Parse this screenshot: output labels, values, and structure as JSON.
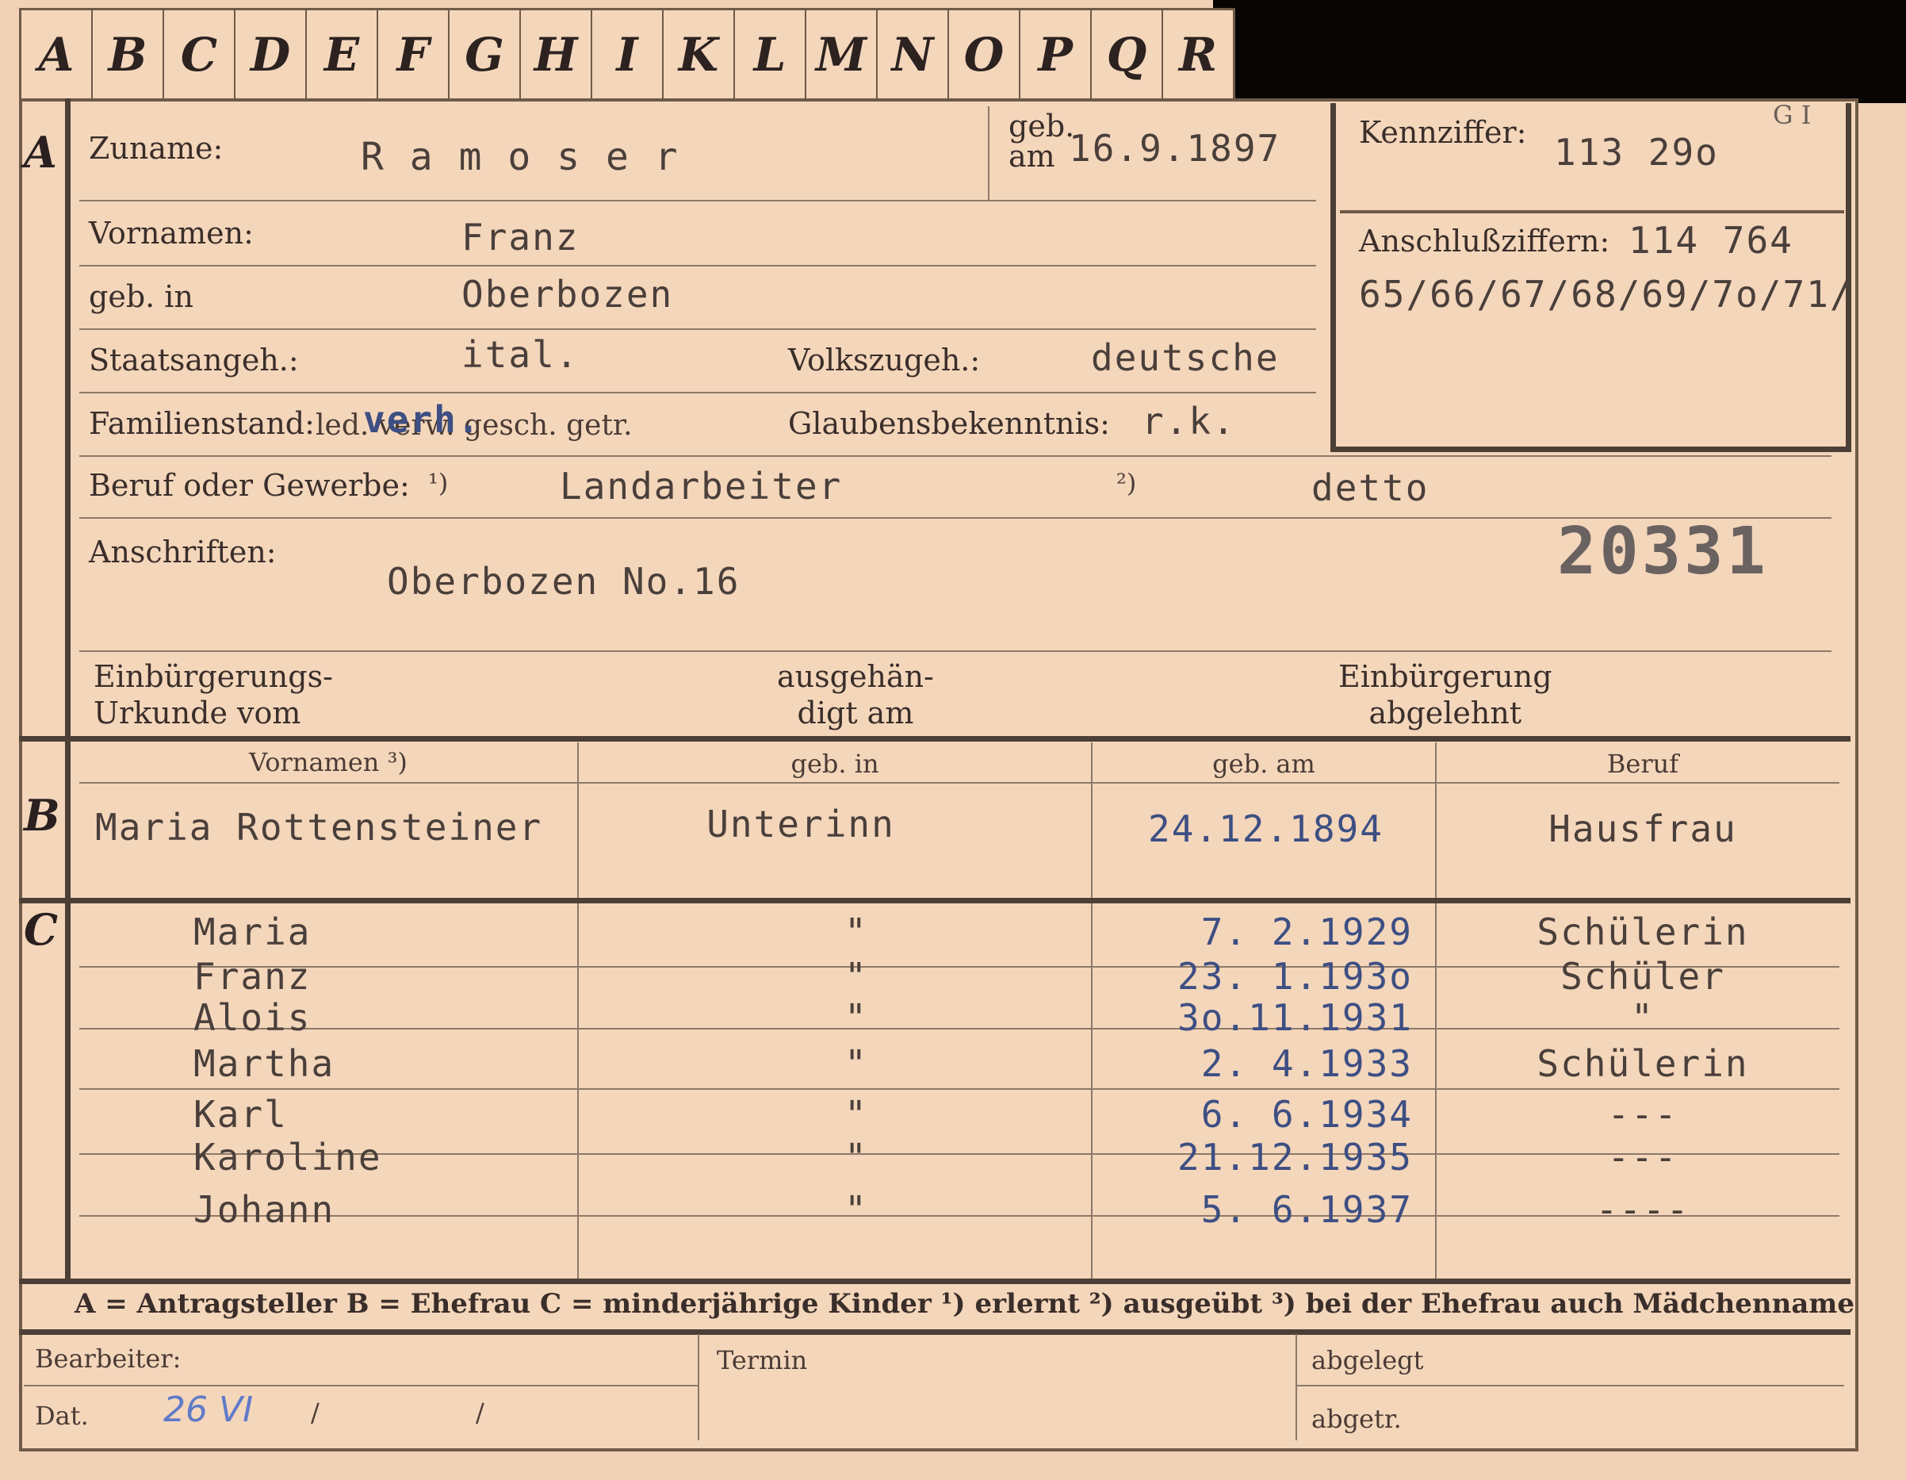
{
  "tabs": [
    "A",
    "B",
    "C",
    "D",
    "E",
    "F",
    "G",
    "H",
    "I",
    "K",
    "L",
    "M",
    "N",
    "O",
    "P",
    "Q",
    "R"
  ],
  "section_a": {
    "letter": "A",
    "zuname_label": "Zuname:",
    "zuname_value": "R a m o s e r",
    "geb_am_label_1": "geb.",
    "geb_am_label_2": "am",
    "geb_am_value": "16.9.1897",
    "kennziffer_label": "Kennziffer:",
    "kennziffer_value": "113 29o",
    "kennziffer_note": "G I",
    "anschluss_label": "Anschlußziffern:",
    "anschluss_value_1": "114 764",
    "anschluss_value_2": "65/66/67/68/69/7o/71/",
    "vornamen_label": "Vornamen:",
    "vornamen_value": "Franz",
    "geb_in_label": "geb. in",
    "geb_in_value": "Oberbozen",
    "staatsangeh_label": "Staatsangeh.:",
    "staatsangeh_value": "ital.",
    "volkszugeh_label": "Volkszugeh.:",
    "volkszugeh_value": "deutsche",
    "familienstand_label": "Familienstand:",
    "familienstand_options": "led. verw. gesch. getr.",
    "familienstand_value": "verh.",
    "glaubens_label": "Glaubensbekenntnis:",
    "glaubens_value": "r.k.",
    "beruf_label": "Beruf oder Gewerbe:",
    "beruf_note1": "¹)",
    "beruf_value1": "Landarbeiter",
    "beruf_note2": "²)",
    "beruf_value2": "detto",
    "anschriften_label": "Anschriften:",
    "anschriften_value": "Oberbozen No.16",
    "stamp_number": "20331",
    "einb_urkunde_1": "Einbürgerungs-",
    "einb_urkunde_2": "Urkunde vom",
    "ausgehaendigt_1": "ausgehän-",
    "ausgehaendigt_2": "digt am",
    "abgelehnt_1": "Einbürgerung",
    "abgelehnt_2": "abgelehnt"
  },
  "section_b": {
    "letter": "B",
    "headers": [
      "Vornamen ³)",
      "geb. in",
      "geb. am",
      "Beruf"
    ],
    "row": [
      "Maria Rottensteiner",
      "Unterinn",
      "24.12.1894",
      "Hausfrau"
    ]
  },
  "section_c": {
    "letter": "C",
    "rows": [
      [
        "Maria",
        "\"",
        "7. 2.1929",
        "Schülerin"
      ],
      [
        "Franz",
        "\"",
        "23. 1.193o",
        "Schüler"
      ],
      [
        "Alois",
        "\"",
        "3o.11.1931",
        "\""
      ],
      [
        "Martha",
        "\"",
        "2. 4.1933",
        "Schülerin"
      ],
      [
        "Karl",
        "\"",
        "6. 6.1934",
        "---"
      ],
      [
        "Karoline",
        "\"",
        "21.12.1935",
        "---"
      ],
      [
        "Johann",
        "\"",
        "5. 6.1937",
        "----"
      ]
    ]
  },
  "legend": "A = Antragsteller   B = Ehefrau   C = minderjährige Kinder   ¹) erlernt   ²) ausgeübt   ³) bei der Ehefrau auch Mädchenname",
  "footer": {
    "bearbeiter_label": "Bearbeiter:",
    "dat_label": "Dat.",
    "dat_value": "26 VI",
    "dat_slash1": "/",
    "dat_slash2": "/",
    "termin_label": "Termin",
    "abgelegt_label": "abgelegt",
    "abgetr_label": "abgetr."
  }
}
